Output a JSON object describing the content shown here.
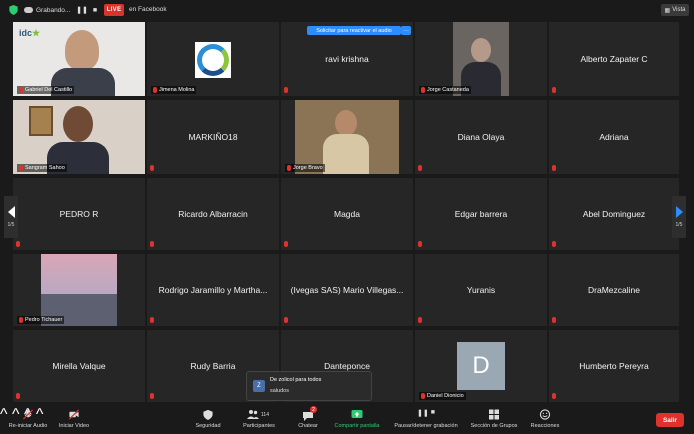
{
  "topbar": {
    "recording_label": "Grabando...",
    "live_badge": "LIVE",
    "live_target": "en Facebook",
    "view_label": "Vista"
  },
  "unmute": {
    "request_label": "Solicitar para reactivar el audio",
    "more_label": "···"
  },
  "pager": {
    "left": "1/5",
    "right": "1/5"
  },
  "video_logo_text": "idc",
  "participants": [
    {
      "name": "Gabriel Del Castillo",
      "video": true
    },
    {
      "name": "Jimena Molina",
      "video": true
    },
    {
      "name": "ravi krishna",
      "video": false
    },
    {
      "name": "Jorge Castaneda",
      "video": true
    },
    {
      "name": "Alberto Zapater C",
      "video": false
    },
    {
      "name": "Sangram Sahoo",
      "video": true
    },
    {
      "name": "MARKIÑO18",
      "video": false
    },
    {
      "name": "Jorge Bravo",
      "video": true
    },
    {
      "name": "Diana Olaya",
      "video": false
    },
    {
      "name": "Adriana",
      "video": false
    },
    {
      "name": "PEDRO R",
      "video": false
    },
    {
      "name": "Ricardo Albarracin",
      "video": false
    },
    {
      "name": "Magda",
      "video": false
    },
    {
      "name": "Edgar barrera",
      "video": false
    },
    {
      "name": "Abel Dominguez",
      "video": false
    },
    {
      "name": "Pedro Tichauer",
      "video": true
    },
    {
      "name": "Rodrigo Jaramillo y Martha...",
      "video": false
    },
    {
      "name": "(Ivegas SAS) Mario Villegas...",
      "video": false
    },
    {
      "name": "Yuranis",
      "video": false
    },
    {
      "name": "DraMezcaline",
      "video": false
    },
    {
      "name": "Mirella Valque",
      "video": false
    },
    {
      "name": "Rudy Barria",
      "video": false
    },
    {
      "name": "Danteponce",
      "video": false
    },
    {
      "name": "Daniel Dionicio",
      "video": true
    },
    {
      "name": "Humberto Pereyra",
      "video": false
    }
  ],
  "avatar_letter": "D",
  "chat": {
    "avatar": "Z",
    "from": "De zolicol para todos",
    "message": "saludos"
  },
  "toolbar": {
    "unmute": "Re-iniciar Audio",
    "start_video": "Iniciar Video",
    "security": "Seguridad",
    "participants": "Participantes",
    "participants_count": "114",
    "chat": "Chatear",
    "chat_badge": "2",
    "share": "Compartir pantalla",
    "record": "Pausar/detener grabación",
    "breakout": "Sección de Grupos",
    "reactions": "Reacciones",
    "leave": "Salir"
  },
  "colors": {
    "active_speaker": "#d6e22f",
    "live_red": "#d9342b",
    "zoom_blue": "#2d8cff",
    "share_green": "#2ecc71",
    "leave_red": "#e0322d"
  }
}
